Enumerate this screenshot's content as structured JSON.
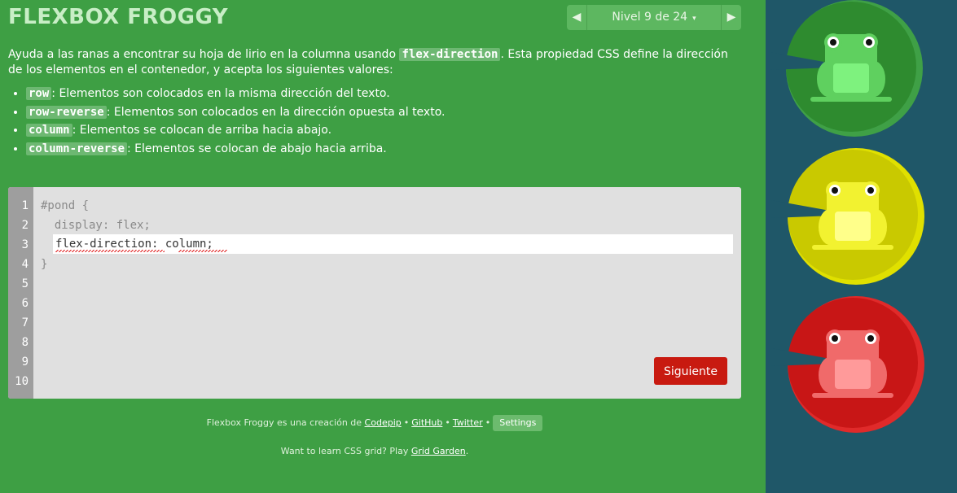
{
  "app": {
    "title": "FLEXBOX FROGGY"
  },
  "level_nav": {
    "prev": "◀",
    "label": "Nivel 9 de 24",
    "caret": "▾",
    "next": "▶"
  },
  "instructions": {
    "intro_before": "Ayuda a las ranas a encontrar su hoja de lirio en la columna usando ",
    "intro_code": "flex-direction",
    "intro_after": ". Esta propiedad CSS define la dirección de los elementos en el contenedor, y acepta los siguientes valores:",
    "items": [
      {
        "code": "row",
        "text": ": Elementos son colocados en la misma dirección del texto."
      },
      {
        "code": "row-reverse",
        "text": ": Elementos son colocados en la dirección opuesta al texto."
      },
      {
        "code": "column",
        "text": ": Elementos se colocan de arriba hacia abajo."
      },
      {
        "code": "column-reverse",
        "text": ": Elementos se colocan de abajo hacia arriba."
      }
    ]
  },
  "editor": {
    "line_numbers": [
      "1",
      "2",
      "3",
      "4",
      "5",
      "6",
      "7",
      "8",
      "9",
      "10"
    ],
    "line1": "#pond {",
    "line2": "  display: flex;",
    "input_value": "flex-direction: column;",
    "line4": "}",
    "next_button": "Siguiente"
  },
  "footer": {
    "credit_before": "Flexbox Froggy es una creación de ",
    "codepip": "Codepip",
    "github": "GitHub",
    "twitter": "Twitter",
    "bullet": "•",
    "settings": "Settings",
    "grid_before": "Want to learn CSS grid? Play ",
    "grid_link": "Grid Garden",
    "grid_after": "."
  },
  "board": {
    "frogs": [
      {
        "color": "green",
        "pad": "#2e8b2f",
        "pad_light": "#3fa046",
        "body": "#5fd05f",
        "belly": "#7ef27e"
      },
      {
        "color": "yellow",
        "pad": "#c9c900",
        "pad_light": "#e0e000",
        "body": "#f2f230",
        "belly": "#ffff8a"
      },
      {
        "color": "red",
        "pad": "#c81616",
        "pad_light": "#e02a2a",
        "body": "#f06a6a",
        "belly": "#ff9a9a"
      }
    ]
  }
}
